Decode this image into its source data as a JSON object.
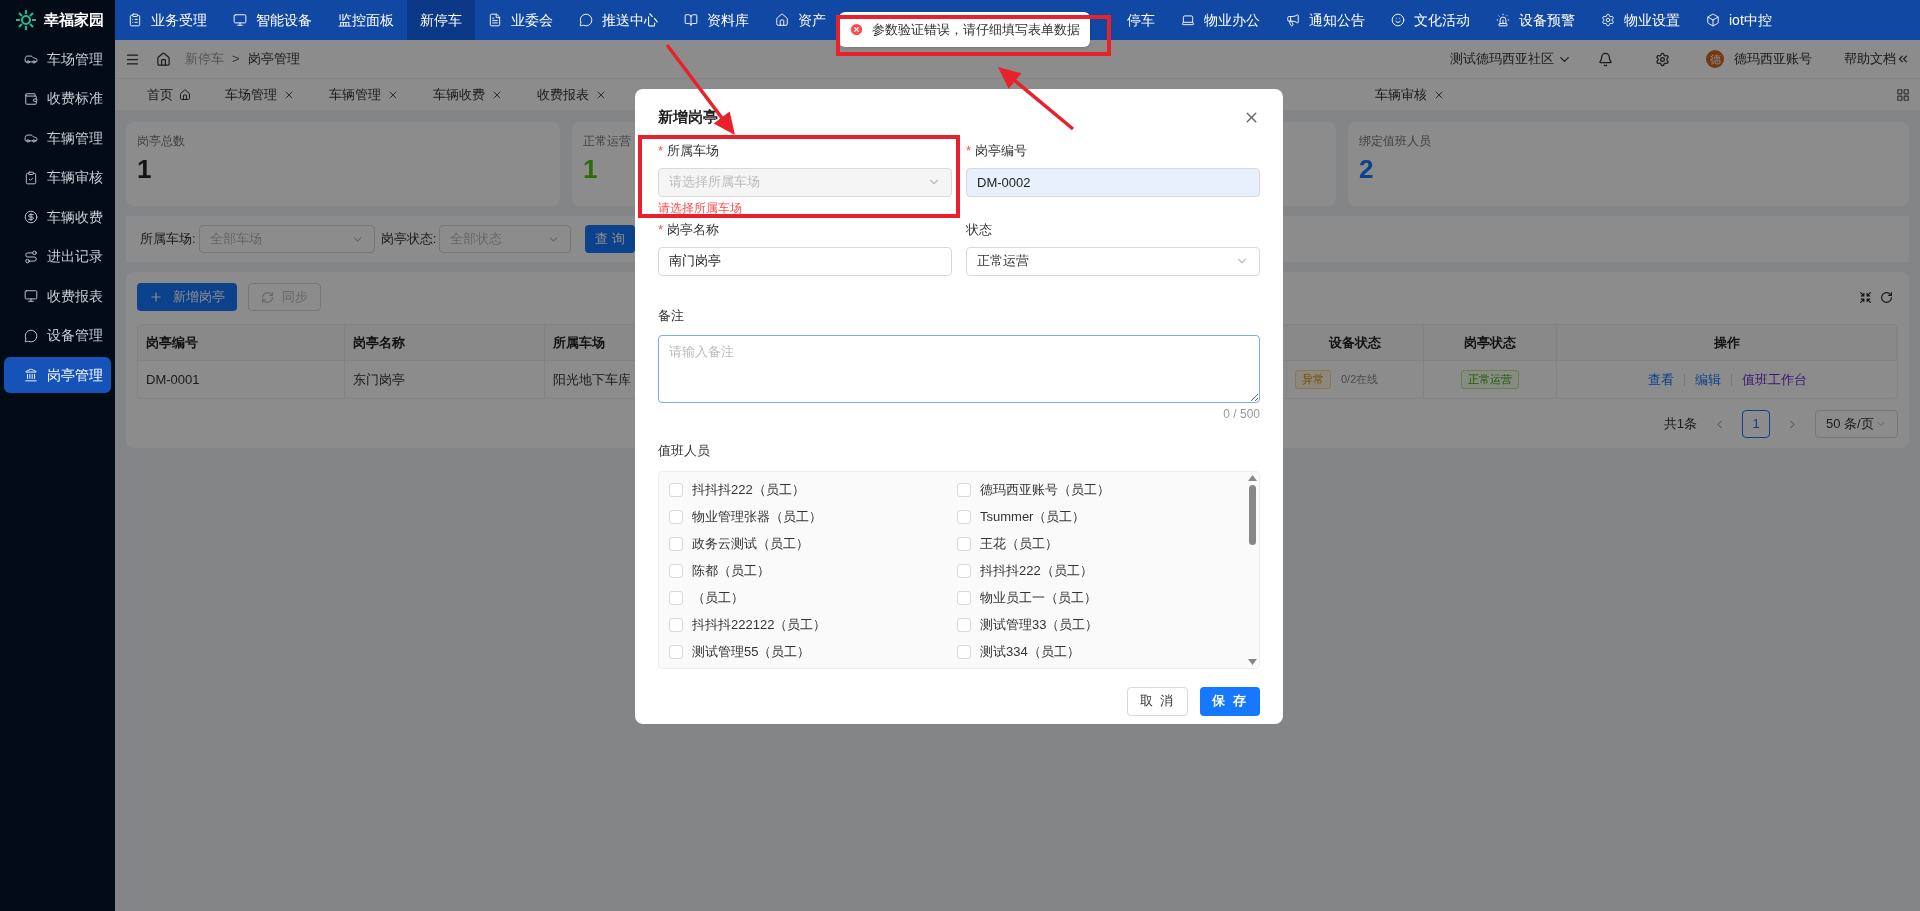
{
  "sidebar": {
    "logo": "幸福家园",
    "items": [
      {
        "label": "车场管理",
        "selected": false
      },
      {
        "label": "收费标准",
        "selected": false
      },
      {
        "label": "车辆管理",
        "selected": false
      },
      {
        "label": "车辆审核",
        "selected": false
      },
      {
        "label": "车辆收费",
        "selected": false
      },
      {
        "label": "进出记录",
        "selected": false
      },
      {
        "label": "收费报表",
        "selected": false
      },
      {
        "label": "设备管理",
        "selected": false
      },
      {
        "label": "岗亭管理",
        "selected": true
      }
    ]
  },
  "top_nav": {
    "items": [
      {
        "label": "业务受理",
        "selected": false
      },
      {
        "label": "智能设备",
        "selected": false
      },
      {
        "label": "监控面板",
        "selected": false
      },
      {
        "label": "新停车",
        "selected": true
      },
      {
        "label": "业委会",
        "selected": false
      },
      {
        "label": "推送中心",
        "selected": false
      },
      {
        "label": "资料库",
        "selected": false
      },
      {
        "label": "资产",
        "selected": false
      },
      {
        "label": "停车",
        "selected": false
      },
      {
        "label": "物业办公",
        "selected": false
      },
      {
        "label": "通知公告",
        "selected": false
      },
      {
        "label": "文化活动",
        "selected": false
      },
      {
        "label": "设备预警",
        "selected": false
      },
      {
        "label": "物业设置",
        "selected": false
      },
      {
        "label": "iot中控",
        "selected": false
      }
    ]
  },
  "header": {
    "breadcrumb": [
      "新停车",
      "岗亭管理"
    ],
    "breadcrumb_separator": ">",
    "community": "测试德玛西亚社区",
    "avatar_initial": "德",
    "user": "德玛西亚账号",
    "help": "帮助文档"
  },
  "tabs": [
    {
      "label": "首页",
      "kind": "home"
    },
    {
      "label": "车场管理",
      "kind": "page"
    },
    {
      "label": "车辆管理",
      "kind": "page"
    },
    {
      "label": "车辆收费",
      "kind": "page"
    },
    {
      "label": "收费报表",
      "kind": "page"
    },
    {
      "label": "车辆审核",
      "kind": "page"
    }
  ],
  "stats": [
    {
      "label": "岗亭总数",
      "value": "1",
      "kind": "total"
    },
    {
      "label": "正常运营",
      "value": "1",
      "kind": "normal"
    },
    {
      "label": "绑定值班人员",
      "value": "2",
      "kind": "staff"
    }
  ],
  "filters": [
    {
      "label": "所属车场:",
      "placeholder": "全部车场"
    },
    {
      "label": "岗亭状态:",
      "placeholder": "全部状态"
    }
  ],
  "query_button": "查 询",
  "toolbar": {
    "add_button": "新增岗亭",
    "sync_button": {
      "label": "同步",
      "disabled": true
    }
  },
  "table": {
    "columns": [
      "岗亭编号",
      "岗亭名称",
      "所属车场",
      "设备状态",
      "岗亭状态",
      "操作"
    ],
    "rows": [
      {
        "cells": [
          "DM-0001",
          "东门岗亭",
          "阳光地下车库"
        ],
        "device_tag": "异常",
        "device_online": "0/2在线",
        "booth_status": "正常运营",
        "actions": [
          {
            "label": "查看",
            "kind": "link"
          },
          {
            "label": "编辑",
            "kind": "link"
          },
          {
            "label": "值班工作台",
            "kind": "workbench"
          }
        ]
      }
    ]
  },
  "pagination": {
    "total": "共1条",
    "pages": [
      {
        "label": "1",
        "selected": true
      }
    ],
    "page_size": "50 条/页"
  },
  "toast": {
    "message": "参数验证错误，请仔细填写表单数据"
  },
  "modal": {
    "title": "新增岗亭",
    "required_mark": "*",
    "fields": [
      {
        "kind": "select",
        "label": "所属车场",
        "required": true,
        "placeholder": "请选择所属车场",
        "error": "请选择所属车场"
      },
      {
        "kind": "input",
        "label": "岗亭编号",
        "required": true,
        "value": "DM-0002"
      },
      {
        "kind": "input",
        "label": "岗亭名称",
        "required": true,
        "value": "南门岗亭"
      },
      {
        "kind": "select",
        "label": "状态",
        "required": false,
        "value": "正常运营"
      }
    ],
    "remark": {
      "label": "备注",
      "placeholder": "请输入备注",
      "counter": "0 / 500"
    },
    "staff": {
      "label": "值班人员",
      "options": [
        {
          "label": "抖抖抖222（员工）",
          "checked": false
        },
        {
          "label": "德玛西亚账号（员工）",
          "checked": false
        },
        {
          "label": "物业管理张器（员工）",
          "checked": false
        },
        {
          "label": "Tsummer（员工）",
          "checked": false
        },
        {
          "label": "政务云测试（员工）",
          "checked": false
        },
        {
          "label": "王花（员工）",
          "checked": false
        },
        {
          "label": "陈都（员工）",
          "checked": false
        },
        {
          "label": "抖抖抖222（员工）",
          "checked": false
        },
        {
          "label": "（员工）",
          "checked": false
        },
        {
          "label": "物业员工一（员工）",
          "checked": false
        },
        {
          "label": "抖抖抖222122（员工）",
          "checked": false
        },
        {
          "label": "测试管理33（员工）",
          "checked": false
        },
        {
          "label": "测试管理55（员工）",
          "checked": false
        },
        {
          "label": "测试334（员工）",
          "checked": false
        }
      ]
    },
    "buttons": [
      {
        "label": "取 消",
        "kind": "default"
      },
      {
        "label": "保 存",
        "kind": "primary"
      }
    ]
  }
}
